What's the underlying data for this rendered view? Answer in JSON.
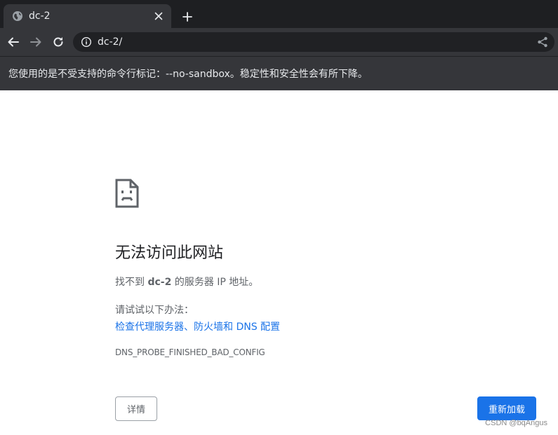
{
  "tab": {
    "title": "dc-2",
    "favicon": "globe-icon",
    "close_icon": "close-icon",
    "new_tab_icon": "plus-icon"
  },
  "toolbar": {
    "back_icon": "arrow-left-icon",
    "forward_icon": "arrow-right-icon",
    "reload_icon": "reload-icon",
    "site_info_icon": "info-icon",
    "url": "dc-2/",
    "share_icon": "share-icon"
  },
  "infobar": {
    "message": "您使用的是不受支持的命令行标记：--no-sandbox。稳定性和安全性会有所下降。"
  },
  "error_page": {
    "icon": "sad-page-icon",
    "title": "无法访问此网站",
    "description_prefix": "找不到 ",
    "description_host": "dc-2",
    "description_suffix": " 的服务器 IP 地址。",
    "try_label": "请试试以下办法：",
    "suggestion_link": "检查代理服务器、防火墙和 DNS 配置",
    "error_code": "DNS_PROBE_FINISHED_BAD_CONFIG",
    "details_button": "详情",
    "reload_button": "重新加载"
  },
  "watermark": "CSDN @bqAngus",
  "colors": {
    "chrome_dark": "#1e1f22",
    "chrome_toolbar": "#35363a",
    "omnibox_bg": "#202124",
    "link_blue": "#1a73e8",
    "text_secondary": "#5f6368",
    "title_text": "#202124"
  }
}
